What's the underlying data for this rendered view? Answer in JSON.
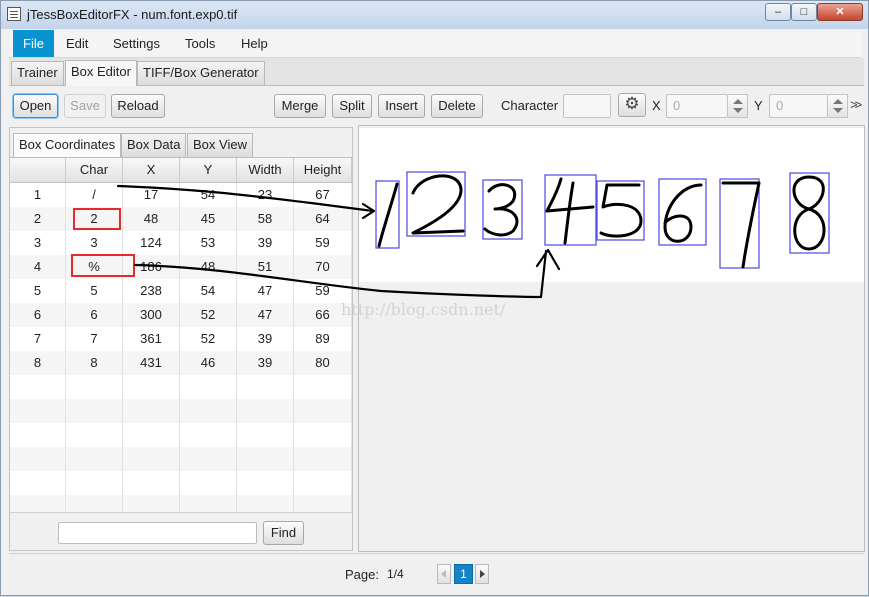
{
  "window": {
    "title": "jTessBoxEditorFX - num.font.exp0.tif",
    "controls": {
      "minimize": "–",
      "maximize": "□",
      "close": "✕"
    }
  },
  "menu": [
    "File",
    "Edit",
    "Settings",
    "Tools",
    "Help"
  ],
  "tabs": [
    "Trainer",
    "Box Editor",
    "TIFF/Box Generator"
  ],
  "toolbar": {
    "open": "Open",
    "save": "Save",
    "reload": "Reload",
    "merge": "Merge",
    "split": "Split",
    "insert": "Insert",
    "delete": "Delete",
    "character_label": "Character",
    "character_value": "",
    "x_label": "X",
    "x_value": "0",
    "y_label": "Y",
    "y_value": "0",
    "settings_icon": "gear-icon",
    "overflow": ">>"
  },
  "left_tabs": [
    "Box Coordinates",
    "Box Data",
    "Box View"
  ],
  "table": {
    "columns": [
      "",
      "Char",
      "X",
      "Y",
      "Width",
      "Height"
    ],
    "rows": [
      [
        "1",
        "/",
        "17",
        "54",
        "23",
        "67"
      ],
      [
        "2",
        "2",
        "48",
        "45",
        "58",
        "64"
      ],
      [
        "3",
        "3",
        "124",
        "53",
        "39",
        "59"
      ],
      [
        "4",
        "%",
        "186",
        "48",
        "51",
        "70"
      ],
      [
        "5",
        "5",
        "238",
        "54",
        "47",
        "59"
      ],
      [
        "6",
        "6",
        "300",
        "52",
        "47",
        "66"
      ],
      [
        "7",
        "7",
        "361",
        "52",
        "39",
        "89"
      ],
      [
        "8",
        "8",
        "431",
        "46",
        "39",
        "80"
      ]
    ]
  },
  "find": {
    "button": "Find",
    "value": ""
  },
  "watermark": "http://blog.csdn.net/",
  "pagination": {
    "label": "Page:",
    "value": "1/4",
    "current": "1"
  },
  "colors": {
    "accent": "#0a93d1",
    "highlight": "#e32b2b",
    "box": "#4a4ae0"
  }
}
